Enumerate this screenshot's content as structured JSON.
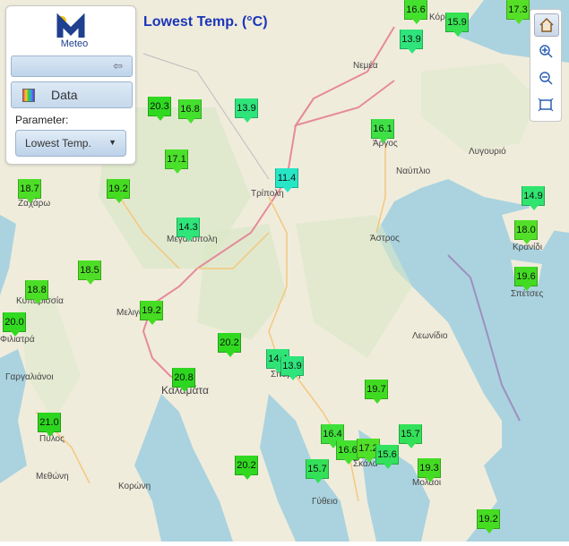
{
  "app": {
    "logo_text": "Meteo",
    "map_title": "Lowest Temp. (°C)"
  },
  "panel": {
    "data_button": "Data",
    "parameter_label": "Parameter:",
    "parameter_value": "Lowest Temp."
  },
  "places": [
    "Κόρινθος",
    "Νεμέα",
    "Άργος",
    "Ναύπλιο",
    "Λυγουριό",
    "Ζαχάρω",
    "Τρίπολη",
    "Μεγαλόπολη",
    "Άστρος",
    "Κρανίδι",
    "Κυπαρισσία",
    "Σπέτσες",
    "Μελιγαλάς",
    "Φιλιατρά",
    "Λεωνίδιο",
    "Γαργαλιάνοι",
    "Καλαμάτα",
    "Σπάρτη",
    "Πύλος",
    "Σκάλα",
    "Μολάοι",
    "Μεθώνη",
    "Κορώνη",
    "Γύθειο"
  ],
  "markers": [
    {
      "value": "16.6",
      "color": "#44e02e"
    },
    {
      "value": "15.9",
      "color": "#35e051"
    },
    {
      "value": "17.3",
      "color": "#55e027"
    },
    {
      "value": "13.9",
      "color": "#2ee47b"
    },
    {
      "value": "20.3",
      "color": "#2fd91f"
    },
    {
      "value": "16.8",
      "color": "#44e02e"
    },
    {
      "value": "13.9",
      "color": "#2ee47b"
    },
    {
      "value": "16.1",
      "color": "#3ee046"
    },
    {
      "value": "17.1",
      "color": "#4be02a"
    },
    {
      "value": "11.4",
      "color": "#27e6c6"
    },
    {
      "value": "18.7",
      "color": "#4dde27"
    },
    {
      "value": "19.2",
      "color": "#45dc22"
    },
    {
      "value": "14.3",
      "color": "#2ee57a"
    },
    {
      "value": "14.9",
      "color": "#30e470"
    },
    {
      "value": "18.0",
      "color": "#52df28"
    },
    {
      "value": "18.5",
      "color": "#4fde27"
    },
    {
      "value": "18.8",
      "color": "#4ade26"
    },
    {
      "value": "19.6",
      "color": "#42db21"
    },
    {
      "value": "20.0",
      "color": "#32da21"
    },
    {
      "value": "19.2",
      "color": "#45dc22"
    },
    {
      "value": "20.2",
      "color": "#30d920"
    },
    {
      "value": "14.4",
      "color": "#2fe477"
    },
    {
      "value": "13.9",
      "color": "#2ee47b"
    },
    {
      "value": "20.8",
      "color": "#2dd61f"
    },
    {
      "value": "19.7",
      "color": "#40db21"
    },
    {
      "value": "21.0",
      "color": "#2cd51e"
    },
    {
      "value": "16.4",
      "color": "#40e03a"
    },
    {
      "value": "16.6",
      "color": "#44e02e"
    },
    {
      "value": "17.2",
      "color": "#50e028"
    },
    {
      "value": "15.6",
      "color": "#33e15c"
    },
    {
      "value": "15.7",
      "color": "#33e158"
    },
    {
      "value": "19.3",
      "color": "#44dc22"
    },
    {
      "value": "20.2",
      "color": "#30d920"
    },
    {
      "value": "15.7",
      "color": "#33e158"
    },
    {
      "value": "19.2",
      "color": "#45dc22"
    }
  ]
}
